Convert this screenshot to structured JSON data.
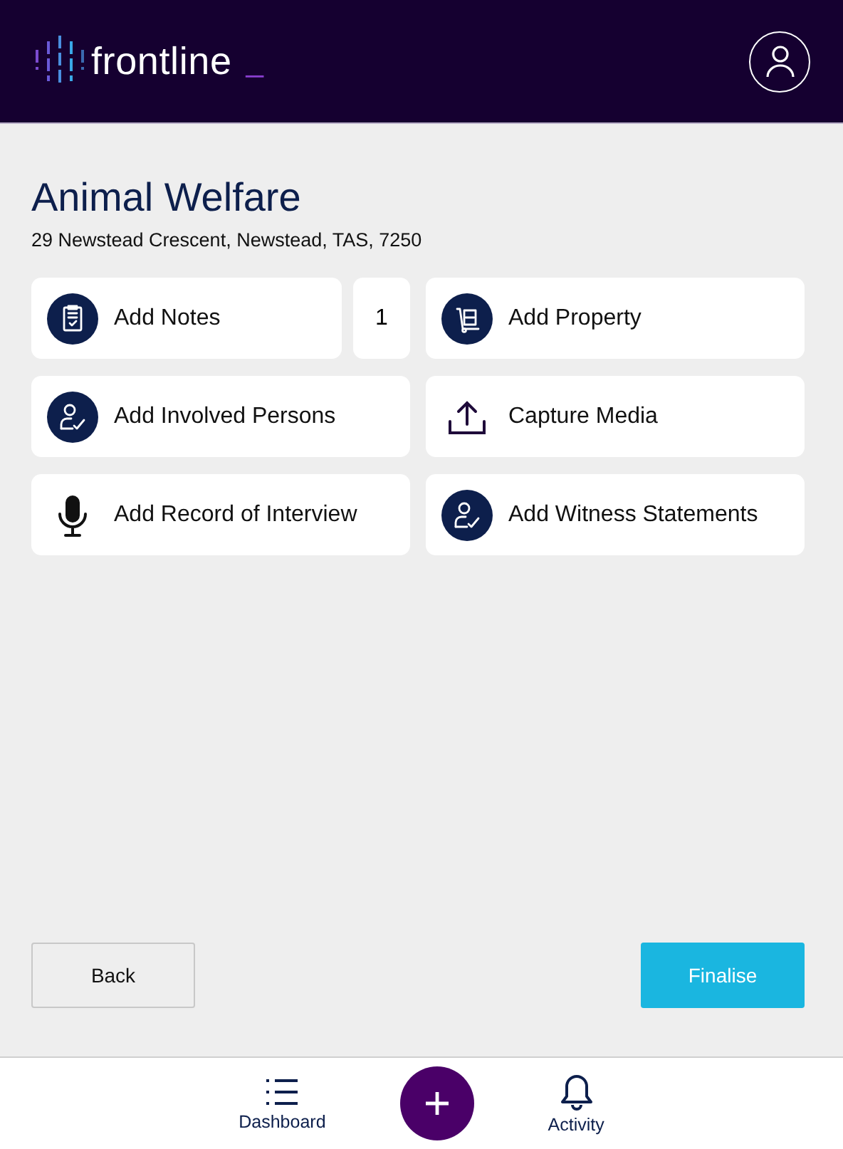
{
  "header": {
    "logo": "frontline",
    "cursor": "_"
  },
  "page": {
    "title": "Animal Welfare",
    "address": "29 Newstead Crescent, Newstead, TAS, 7250"
  },
  "actions": [
    {
      "label": "Add Notes",
      "count": "1"
    },
    {
      "label": "Add Property"
    },
    {
      "label": "Add Involved Persons"
    },
    {
      "label": "Capture Media"
    },
    {
      "label": "Add Record of Interview"
    },
    {
      "label": "Add Witness Statements"
    }
  ],
  "buttons": {
    "back": "Back",
    "finalise": "Finalise"
  },
  "nav": [
    {
      "label": "Dashboard"
    },
    {
      "kind": "add"
    },
    {
      "label": "Activity"
    }
  ]
}
